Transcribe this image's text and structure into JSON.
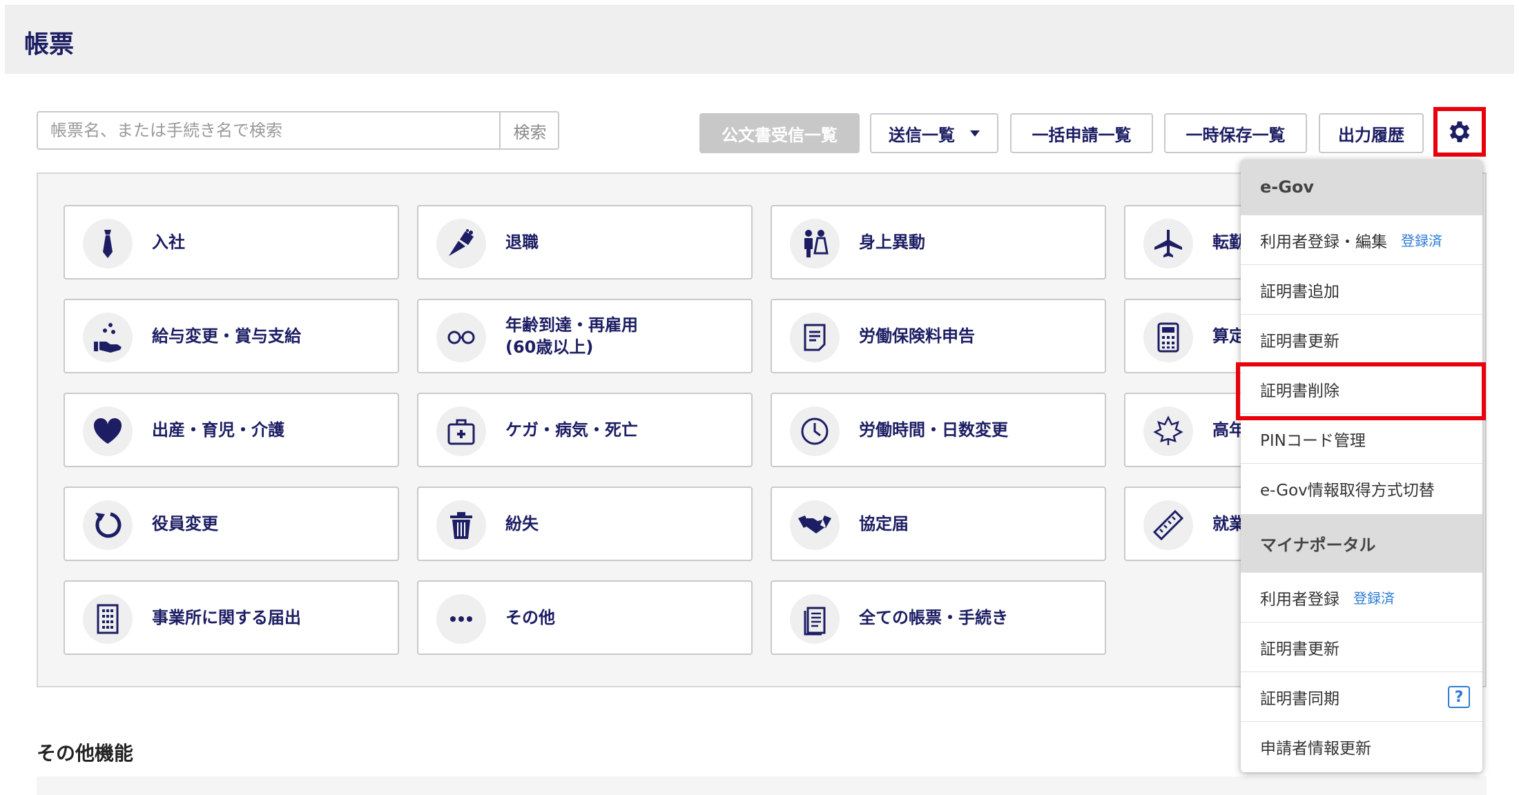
{
  "header": {
    "title": "帳票"
  },
  "search": {
    "placeholder": "帳票名、または手続き名で検索",
    "button_label": "検索"
  },
  "toolbar": {
    "public_docs_label": "公文書受信一覧",
    "send_list_label": "送信一覧",
    "bulk_apply_label": "一括申請一覧",
    "temp_save_label": "一時保存一覧",
    "output_history_label": "出力履歴"
  },
  "tiles": [
    {
      "label": "入社",
      "icon": "tie-icon"
    },
    {
      "label": "退職",
      "icon": "bouquet-icon"
    },
    {
      "label": "身上異動",
      "icon": "wedding-couple-icon"
    },
    {
      "label": "転勤",
      "icon": "airplane-icon"
    },
    {
      "label": "給与変更・賞与支給",
      "icon": "coins-hand-icon"
    },
    {
      "label": "年齢到達・再雇用\n(60歳以上)",
      "icon": "glasses-icon"
    },
    {
      "label": "労働保険料申告",
      "icon": "document-icon"
    },
    {
      "label": "算定",
      "icon": "calculator-icon"
    },
    {
      "label": "出産・育児・介護",
      "icon": "heart-icon"
    },
    {
      "label": "ケガ・病気・死亡",
      "icon": "first-aid-kit-icon"
    },
    {
      "label": "労働時間・日数変更",
      "icon": "clock-icon"
    },
    {
      "label": "高年",
      "icon": "maple-leaf-icon"
    },
    {
      "label": "役員変更",
      "icon": "refresh-icon"
    },
    {
      "label": "紛失",
      "icon": "trash-icon"
    },
    {
      "label": "協定届",
      "icon": "handshake-icon"
    },
    {
      "label": "就業",
      "icon": "ruler-icon"
    },
    {
      "label": "事業所に関する届出",
      "icon": "building-icon"
    },
    {
      "label": "その他",
      "icon": "more-icon"
    },
    {
      "label": "全ての帳票・手続き",
      "icon": "documents-icon"
    }
  ],
  "other_section": {
    "title": "その他機能"
  },
  "dropdown": {
    "egov_header": "e-Gov",
    "egov_items": [
      {
        "label": "利用者登録・編集",
        "badge": "登録済"
      },
      {
        "label": "証明書追加"
      },
      {
        "label": "証明書更新"
      },
      {
        "label": "証明書削除"
      },
      {
        "label": "PINコード管理"
      },
      {
        "label": "e-Gov情報取得方式切替"
      }
    ],
    "myna_header": "マイナポータル",
    "myna_items": [
      {
        "label": "利用者登録",
        "badge": "登録済"
      },
      {
        "label": "証明書更新"
      },
      {
        "label": "証明書同期",
        "help": "?"
      },
      {
        "label": "申請者情報更新"
      }
    ]
  },
  "colors": {
    "primary": "#1c1d63",
    "highlight": "#e8000c",
    "link": "#2a7ad5"
  }
}
